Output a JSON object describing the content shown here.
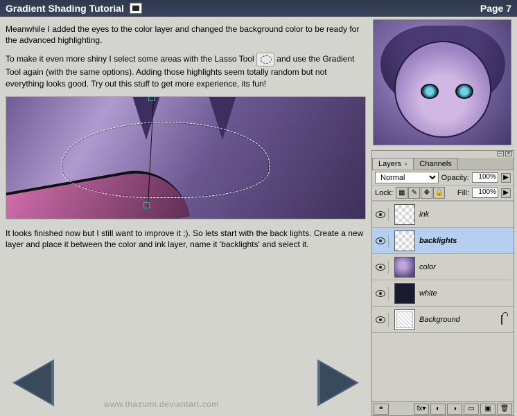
{
  "titlebar": {
    "title": "Gradient Shading Tutorial",
    "page_label": "Page 7"
  },
  "paragraphs": {
    "p1": "Meanwhile I added the eyes to the color layer and changed the background color to be ready for the advanced highlighting.",
    "p2a": "To make it even more shiny I select some areas with the Lasso Tool ",
    "p2b": " and use the Gradient Tool again (with the same options). Adding those highlights seem totally random but not  everything looks good. Try out this stuff to get more experience, its fun!",
    "p3": "It looks finished now but I still want to improve it ;). So lets start with the back lights. Create a  new layer and place it between the color and ink layer, name it 'backlights' and select it."
  },
  "layers_panel": {
    "tabs": {
      "layers": "Layers",
      "channels": "Channels"
    },
    "blend_mode": "Normal",
    "opacity_label": "Opacity:",
    "opacity_value": "100%",
    "lock_label": "Lock:",
    "fill_label": "Fill:",
    "fill_value": "100%",
    "layers": [
      {
        "name": "ink",
        "selected": false,
        "locked": false,
        "thumb": "checker"
      },
      {
        "name": "backlights",
        "selected": true,
        "locked": false,
        "thumb": "checker"
      },
      {
        "name": "color",
        "selected": false,
        "locked": false,
        "thumb": "color"
      },
      {
        "name": "white",
        "selected": false,
        "locked": false,
        "thumb": "white"
      },
      {
        "name": "Background",
        "selected": false,
        "locked": true,
        "thumb": "bg"
      }
    ]
  },
  "watermark": "www.thazumi.deviantart.com"
}
